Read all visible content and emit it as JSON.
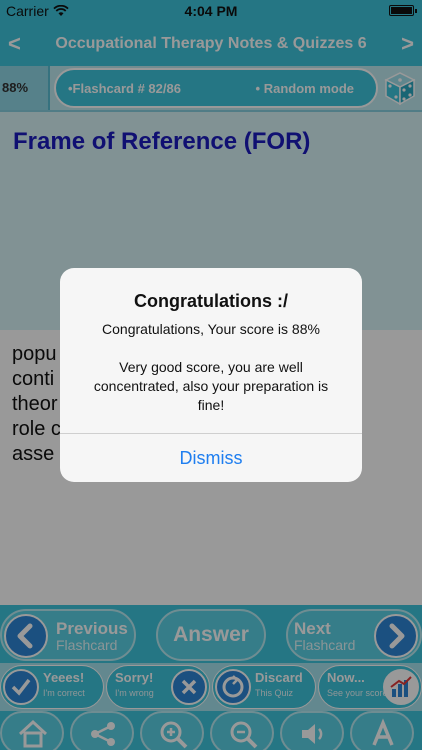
{
  "status_bar": {
    "carrier": "Carrier",
    "time": "4:04 PM"
  },
  "nav": {
    "prev_symbol": "<",
    "title": "Occupational Therapy Notes & Quizzes 6",
    "next_symbol": ">"
  },
  "info_bar": {
    "percent": "88%",
    "flashcard": "•Flashcard #  82/86",
    "mode": "• Random mode"
  },
  "card": {
    "title": "Frame of Reference (FOR)",
    "answer_lines": [
      "popu",
      "conti",
      "theor",
      "role c",
      "asse"
    ]
  },
  "controls": {
    "previous": {
      "main": "Previous",
      "sub": "Flashcard"
    },
    "answer": "Answer",
    "next": {
      "main": "Next",
      "sub": "Flashcard"
    },
    "yes": {
      "main": "Yeees!",
      "sub": "I'm correct"
    },
    "sorry": {
      "main": "Sorry!",
      "sub": "I'm wrong"
    },
    "discard": {
      "main": "Discard",
      "sub": "This Quiz"
    },
    "now": {
      "main": "Now...",
      "sub": "See your score"
    }
  },
  "alert": {
    "title": "Congratulations :/",
    "line1": "Congratulations, Your score is 88%",
    "line2": "Very good score, you are well concentrated, also your preparation is fine!",
    "dismiss": "Dismiss"
  },
  "colors": {
    "accent": "#3fc5dc",
    "title_blue": "#1c1bbf",
    "button_blue": "#2d86d6",
    "link_blue": "#1e7ef0"
  }
}
